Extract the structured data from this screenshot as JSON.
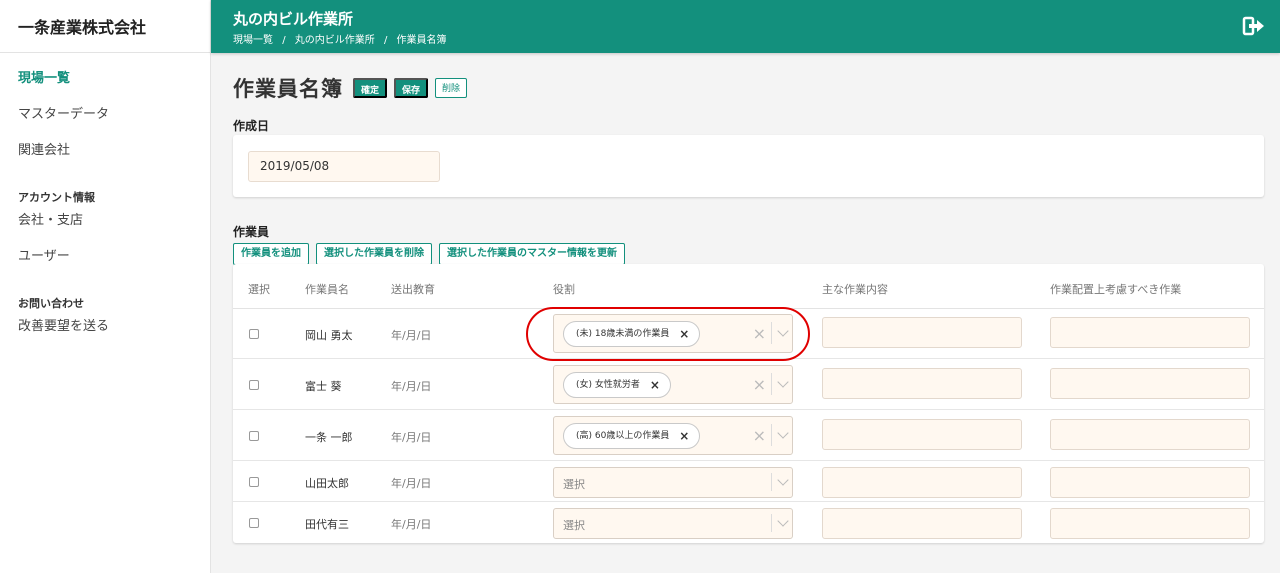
{
  "brand": "一条産業株式会社",
  "sidebar": {
    "items": [
      {
        "label": "現場一覧",
        "active": true
      },
      {
        "label": "マスターデータ"
      },
      {
        "label": "関連会社"
      }
    ],
    "section_account": "アカウント情報",
    "account_items": [
      {
        "label": "会社・支店"
      },
      {
        "label": "ユーザー"
      }
    ],
    "section_contact": "お問い合わせ",
    "contact_items": [
      {
        "label": "改善要望を送る"
      }
    ]
  },
  "header": {
    "title": "丸の内ビル作業所",
    "breadcrumb": [
      "現場一覧",
      "/",
      "丸の内ビル作業所",
      "/",
      "作業員名簿"
    ],
    "logout_icon": "sign-out-icon"
  },
  "page": {
    "title": "作業員名簿",
    "buttons": {
      "confirm": "確定",
      "save": "保存",
      "delete": "削除"
    }
  },
  "created": {
    "label": "作成日",
    "value": "2019/05/08"
  },
  "workers": {
    "label": "作業員",
    "actions": {
      "add": "作業員を追加",
      "delete_selected": "選択した作業員を削除",
      "update_master": "選択した作業員のマスター情報を更新"
    },
    "columns": [
      "選択",
      "作業員名",
      "送出教育",
      "役割",
      "主な作業内容",
      "作業配置上考慮すべき作業"
    ],
    "rows": [
      {
        "name": "岡山 勇太",
        "education": "年/月/日",
        "role": "(未) 18歳未満の作業員"
      },
      {
        "name": "富士 葵",
        "education": "年/月/日",
        "role": "(女) 女性就労者"
      },
      {
        "name": "一条 一郎",
        "education": "年/月/日",
        "role": "(高) 60歳以上の作業員"
      },
      {
        "name": "山田太郎",
        "education": "年/月/日",
        "role": ""
      },
      {
        "name": "田代有三",
        "education": "年/月/日",
        "role": ""
      }
    ],
    "select_placeholder": "選択",
    "tag_remove": "×",
    "clear": "×"
  },
  "colors": {
    "accent": "#13907d",
    "input_bg": "#fff8f0",
    "highlight": "#e00000"
  }
}
